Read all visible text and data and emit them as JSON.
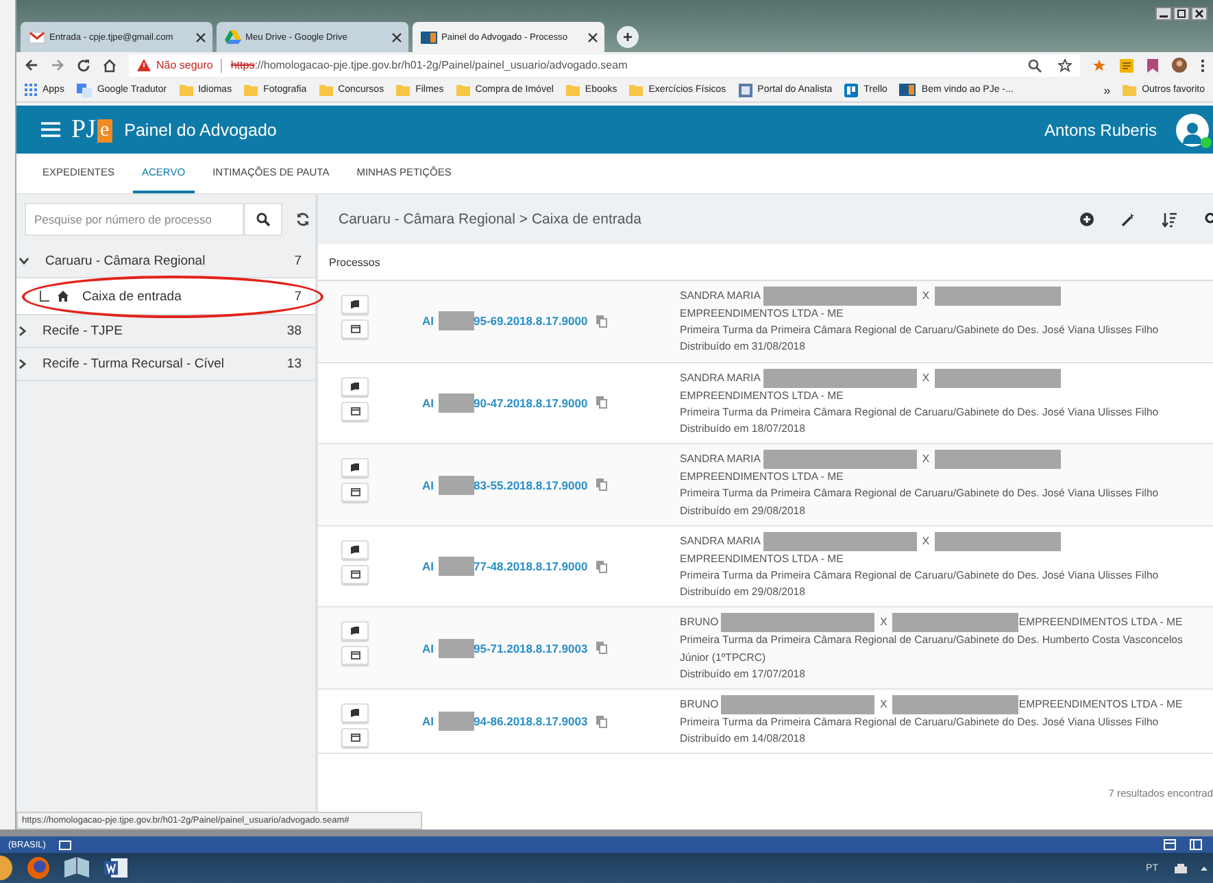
{
  "browser": {
    "tabs": [
      {
        "title": "Entrada - cpje.tjpe@gmail.com",
        "kind": "mail",
        "selected": false
      },
      {
        "title": "Meu Drive - Google Drive",
        "kind": "drive",
        "selected": false
      },
      {
        "title": "Painel do Advogado - Processo",
        "kind": "pje",
        "selected": true
      }
    ],
    "new_tab": "+",
    "address": {
      "warning": "Não seguro",
      "scheme": "https",
      "rest": "://homologacao-pje.tjpe.gov.br/h01-2g/Painel/painel_usuario/advogado.seam"
    },
    "bookmarks": [
      {
        "label": "Apps",
        "kind": "apps"
      },
      {
        "label": "Google Tradutor",
        "kind": "translate"
      },
      {
        "label": "Idiomas",
        "kind": "folder"
      },
      {
        "label": "Fotografia",
        "kind": "folder"
      },
      {
        "label": "Concursos",
        "kind": "folder"
      },
      {
        "label": "Filmes",
        "kind": "folder"
      },
      {
        "label": "Compra de Imóvel",
        "kind": "folder"
      },
      {
        "label": "Ebooks",
        "kind": "folder"
      },
      {
        "label": "Exercícios Físicos",
        "kind": "folder"
      },
      {
        "label": "Portal do Analista",
        "kind": "page"
      },
      {
        "label": "Trello",
        "kind": "trello"
      },
      {
        "label": "Bem vindo ao PJe -...",
        "kind": "pje"
      }
    ],
    "bookmarks_overflow": "»",
    "other_bookmarks": "Outros favorito"
  },
  "app": {
    "logo": {
      "text": "PJ",
      "accent": "e"
    },
    "title": "Painel do Advogado",
    "user": "Antons Ruberis",
    "online": true
  },
  "nav_tabs": [
    {
      "label": "EXPEDIENTES",
      "selected": false
    },
    {
      "label": "ACERVO",
      "selected": true
    },
    {
      "label": "INTIMAÇÕES DE PAUTA",
      "selected": false
    },
    {
      "label": "MINHAS PETIÇÕES",
      "selected": false
    }
  ],
  "sidebar": {
    "search": {
      "placeholder": "Pesquise por número de processo"
    },
    "tree": [
      {
        "label": "Caruaru - Câmara Regional",
        "count": "7",
        "expanded": true,
        "selected": false,
        "children": [
          {
            "label": "Caixa de entrada",
            "count": "7",
            "selected": true,
            "circled": true
          }
        ]
      },
      {
        "label": "Recife - TJPE",
        "count": "38",
        "expanded": false,
        "selected": false
      },
      {
        "label": "Recife - Turma Recursal - Cível",
        "count": "13",
        "expanded": false,
        "selected": false
      }
    ]
  },
  "content": {
    "breadcrumb": "Caruaru - Câmara Regional > Caixa de entrada",
    "list_title": "Processos",
    "processes": [
      {
        "class": "AI",
        "number_end": "95-69.2018.8.17.9000",
        "party_a": "SANDRA MARIA",
        "separator": "X",
        "party_b": "EMPREENDIMENTOS LTDA - ME",
        "court": "Primeira Turma da Primeira Câmara Regional de Caruaru/Gabinete do Des. José Viana Ulisses Filho",
        "distributed": "Distribuído em 31/08/2018"
      },
      {
        "class": "AI",
        "number_end": "90-47.2018.8.17.9000",
        "party_a": "SANDRA MARIA",
        "separator": "X",
        "party_b": "EMPREENDIMENTOS LTDA - ME",
        "court": "Primeira Turma da Primeira Câmara Regional de Caruaru/Gabinete do Des. José Viana Ulisses Filho",
        "distributed": "Distribuído em 18/07/2018"
      },
      {
        "class": "AI",
        "number_end": "83-55.2018.8.17.9000",
        "party_a": "SANDRA MARIA",
        "separator": "X",
        "party_b": "EMPREENDIMENTOS LTDA - ME",
        "court": "Primeira Turma da Primeira Câmara Regional de Caruaru/Gabinete do Des. José Viana Ulisses Filho",
        "distributed": "Distribuído em 29/08/2018"
      },
      {
        "class": "AI",
        "number_end": "77-48.2018.8.17.9000",
        "party_a": "SANDRA MARIA",
        "separator": "X",
        "party_b": "EMPREENDIMENTOS LTDA - ME",
        "court": "Primeira Turma da Primeira Câmara Regional de Caruaru/Gabinete do Des. José Viana Ulisses Filho",
        "distributed": "Distribuído em 29/08/2018"
      },
      {
        "class": "AI",
        "number_end": "95-71.2018.8.17.9003",
        "party_a": "BRUNO",
        "separator": "X",
        "party_b": "EMPREENDIMENTOS LTDA - ME",
        "court": "Primeira Turma da Primeira Câmara Regional de Caruaru/Gabinete do Des. Humberto Costa Vasconcelos Júnior (1ºTPCRC)",
        "distributed": "Distribuído em 17/07/2018"
      },
      {
        "class": "AI",
        "number_end": "94-86.2018.8.17.9003",
        "party_a": "BRUNO",
        "separator": "X",
        "party_b": "EMPREENDIMENTOS LTDA - ME",
        "court": "Primeira Turma da Primeira Câmara Regional de Caruaru/Gabinete do Des. José Viana Ulisses Filho",
        "distributed": "Distribuído em 14/08/2018"
      }
    ],
    "footer": "7 resultados encontrad"
  },
  "status_url": "https://homologacao-pje.tjpe.gov.br/h01-2g/Painel/painel_usuario/advogado.seam#",
  "desktop": {
    "word_status": "(BRASIL)",
    "language": "PT"
  }
}
